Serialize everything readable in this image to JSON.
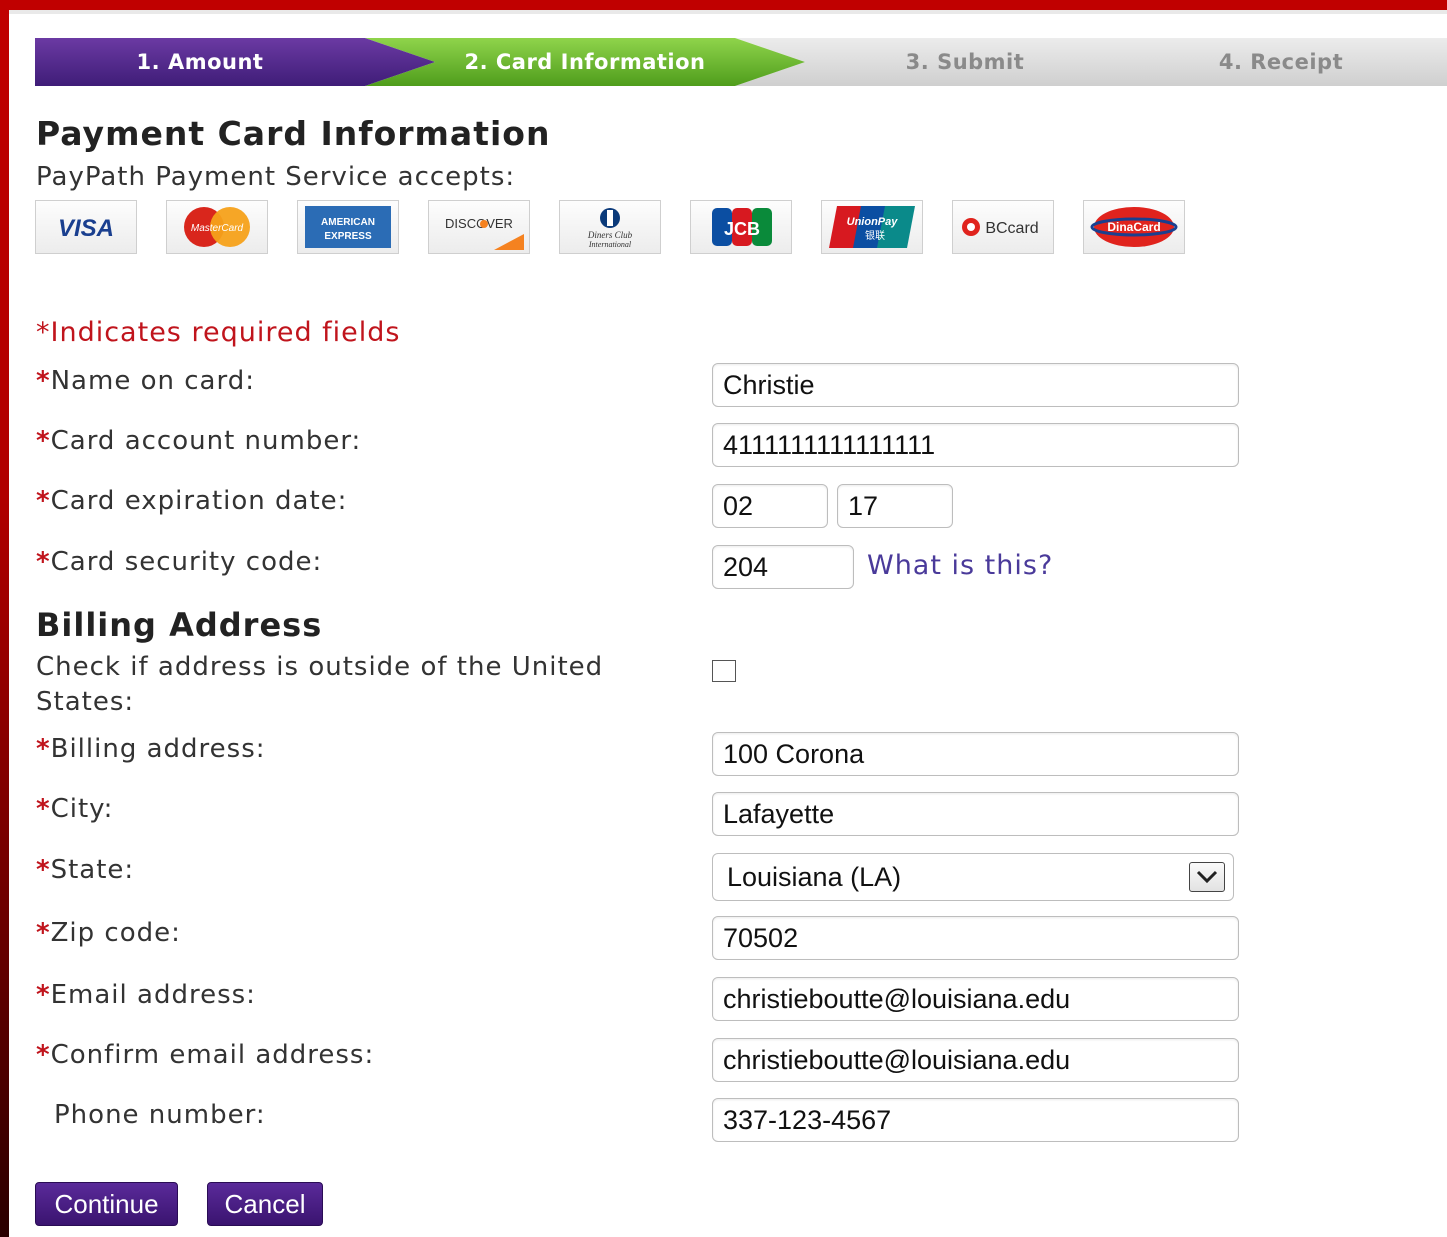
{
  "steps": [
    {
      "label": "1. Amount",
      "state": "completed"
    },
    {
      "label": "2. Card Information",
      "state": "active"
    },
    {
      "label": "3. Submit",
      "state": "pending"
    },
    {
      "label": "4. Receipt",
      "state": "pending"
    }
  ],
  "header": {
    "title": "Payment Card Information",
    "accepts": "PayPath Payment Service accepts:"
  },
  "cards": [
    {
      "name": "visa-logo",
      "text": "VISA"
    },
    {
      "name": "mastercard-logo",
      "text": "MasterCard"
    },
    {
      "name": "american-express-logo",
      "text": "AMERICAN EXPRESS"
    },
    {
      "name": "discover-logo",
      "text": "DISCOVER"
    },
    {
      "name": "diners-club-logo",
      "text": "Diners Club International"
    },
    {
      "name": "jcb-logo",
      "text": "JCB"
    },
    {
      "name": "unionpay-logo",
      "text": "UnionPay 银联"
    },
    {
      "name": "bccard-logo",
      "text": "BCcard"
    },
    {
      "name": "dinacard-logo",
      "text": "DinaCard"
    }
  ],
  "required_note": "*Indicates required fields",
  "card_form": {
    "name_label": "Name on card:",
    "name_value": "Christie",
    "number_label": "Card account number:",
    "number_value": "4111111111111111",
    "exp_label": "Card expiration date:",
    "exp_month": "02",
    "exp_year": "17",
    "cvv_label": "Card security code:",
    "cvv_value": "204",
    "cvv_help": "What is this?"
  },
  "billing": {
    "title": "Billing Address",
    "outside_label": "Check if address is outside of the United States:",
    "outside_checked": false,
    "address_label": "Billing address:",
    "address_value": "100 Corona",
    "city_label": "City:",
    "city_value": "Lafayette",
    "state_label": "State:",
    "state_value": "Louisiana (LA)",
    "zip_label": "Zip code:",
    "zip_value": "70502",
    "email_label": "Email address:",
    "email_value": "christieboutte@louisiana.edu",
    "confirm_email_label": "Confirm email address:",
    "confirm_email_value": "christieboutte@louisiana.edu",
    "phone_label": "Phone number:",
    "phone_value": "337-123-4567"
  },
  "buttons": {
    "continue": "Continue",
    "cancel": "Cancel"
  },
  "colors": {
    "brand_purple": "#4a2188",
    "active_green": "#6bb52d",
    "required_red": "#c0141c",
    "frame_red": "#c00000"
  }
}
